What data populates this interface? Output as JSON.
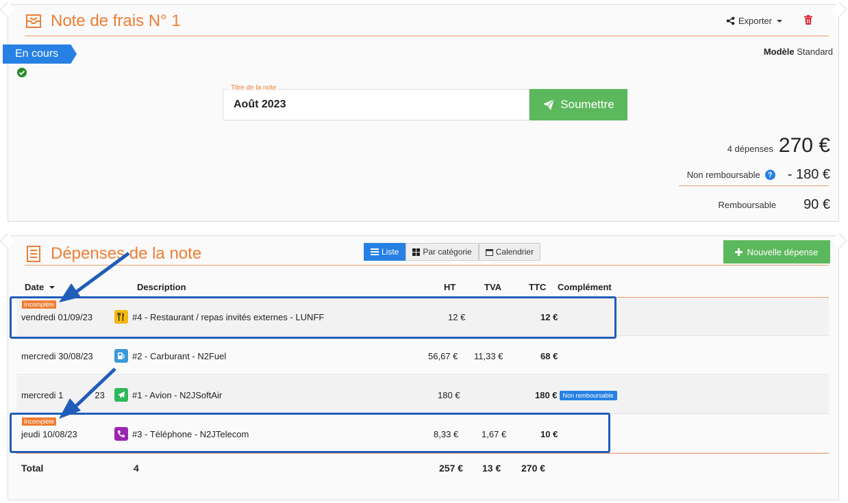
{
  "note": {
    "title": "Note de frais N° 1",
    "export_label": "Exporter",
    "status": "En cours",
    "model_label": "Modèle",
    "model_value": "Standard",
    "title_field_label": "Titre de la note",
    "title_field_value": "Août 2023",
    "submit_label": "Soumettre",
    "count_text": "4 dépenses",
    "total_amount": "270 €",
    "non_refundable_label": "Non remboursable",
    "non_refundable_amount": "- 180 €",
    "refundable_label": "Remboursable",
    "refundable_amount": "90 €"
  },
  "expenses": {
    "title": "Dépenses de la note",
    "views": [
      "Liste",
      "Par catégorie",
      "Calendrier"
    ],
    "new_button": "Nouvelle dépense",
    "columns": {
      "date": "Date",
      "description": "Description",
      "ht": "HT",
      "tva": "TVA",
      "ttc": "TTC",
      "complement": "Complément"
    },
    "rows": [
      {
        "tag": "Incomplète",
        "date": "vendredi 01/09/23",
        "icon": "restaurant-icon",
        "icon_color": "#f2b90f",
        "description": "#4 - Restaurant / repas invités externes - LUNFF",
        "ht": "12 €",
        "tva": "",
        "ttc": "12 €",
        "complement": ""
      },
      {
        "tag": "",
        "date": "mercredi 30/08/23",
        "icon": "fuel-icon",
        "icon_color": "#3a9ad9",
        "description": "#2 - Carburant - N2Fuel",
        "ht": "56,67 €",
        "tva": "11,33 €",
        "ttc": "68 €",
        "complement": ""
      },
      {
        "tag": "",
        "date": "mercredi 1",
        "date_tail": "23",
        "icon": "plane-icon",
        "icon_color": "#2eb85c",
        "description": "#1 - Avion - N2JSoftAir",
        "ht": "180 €",
        "tva": "",
        "ttc": "180 €",
        "complement": "Non remboursable"
      },
      {
        "tag": "Incomplète",
        "date": "jeudi 10/08/23",
        "icon": "phone-icon",
        "icon_color": "#9b27b0",
        "description": "#3 - Téléphone - N2JTelecom",
        "ht": "8,33 €",
        "tva": "1,67 €",
        "ttc": "10 €",
        "complement": ""
      }
    ],
    "total": {
      "label": "Total",
      "count": "4",
      "ht": "257 €",
      "tva": "13 €",
      "ttc": "270 €"
    }
  },
  "colors": {
    "accent": "#ef7d33",
    "primary": "#2780e3",
    "success": "#5cb85c",
    "annotation": "#1f5db8"
  }
}
